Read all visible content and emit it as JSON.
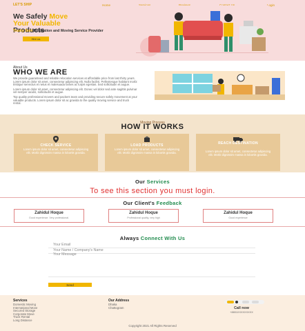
{
  "nav": {
    "logo": "LET'S SHIP",
    "links": [
      "Home",
      "Services",
      "Reviews",
      "Contact Us",
      "Login"
    ]
  },
  "hero": {
    "title_pre": "We Safely ",
    "title_accent1": "Move",
    "title_line2_accent": "Your Valuable",
    "title_line3": "Products",
    "sub_accent": "Trusty Sort",
    "sub_rest": " Relocation and Moving Service Provider",
    "cta": "Hire us"
  },
  "about": {
    "kicker": "About Us",
    "title": "WHO WE ARE",
    "p1": "We provide guaranteed and reliable relocation services at affordable price from last thirty years. Lorem ipsum dolor sit amet, consectetur adipiscing elit. Nulla facilisi. Pellentesque habitant morbi tristique senectus et netus et malesuada fames ac turpis egestas. Sed sollicitudin et augue.",
    "p2": "Lorem ipsum dolor sit amet, consectetur adipiscing elit. Donec vel dolor sed ante sagittis pulvinar vel semper iaculis, sollicitudin et augue.",
    "p3": "Top quality professional movers and packers team and providing secure safely movement at your valuable products. Lorem ipsum dolor sit ac gravida to the quality moving service and truck rental."
  },
  "how": {
    "kicker": "Moving Process",
    "title": "HOW IT WORKS",
    "cards": [
      {
        "icon": "map-pin-icon",
        "title": "CHECK SERVICE",
        "text": "Lorem ipsum dolor sit amet, consectetur adipiscing elit. Morbi dignissim massa in lobortis gravida."
      },
      {
        "icon": "box-icon",
        "title": "LOAD PRODUCTS",
        "text": "Lorem ipsum dolor sit amet, consectetur adipiscing elit. Morbi dignissim massa in lobortis gravida."
      },
      {
        "icon": "truck-icon",
        "title": "REACH DESTINATION",
        "text": "Lorem ipsum dolor sit amet, consectetur adipiscing elit. Morbi dignissim massa in lobortis gravida."
      }
    ]
  },
  "services": {
    "title_pre": "Our ",
    "title_accent": "Services",
    "login_msg": "To see this section you must login."
  },
  "feedback": {
    "title_pre": "Our Client's ",
    "title_accent": "Feedback",
    "items": [
      {
        "name": "Zahidul Hoque",
        "text": "Good experience. Very professional."
      },
      {
        "name": "Zahidul Hoque",
        "text": "Professional quality, very high"
      },
      {
        "name": "Zahidul Hoque",
        "text": "Good experience"
      }
    ]
  },
  "contact": {
    "title_pre": "Always ",
    "title_accent": "Connect With Us",
    "email_ph": "Your Email",
    "name_ph": "Your Name / Company's Name",
    "message_ph": "Your Message",
    "send": "Send"
  },
  "footer": {
    "services_head": "Services",
    "services": [
      "Domestic Moving",
      "International Move",
      "Secured Storage",
      "Corporate Move",
      "Truck Rental",
      "Long Distance"
    ],
    "address_head": "Our Address",
    "address": [
      "Dhaka",
      "Chattogram"
    ],
    "call_label": "Call now",
    "phone": "+8801XXXXXXXXX",
    "copyright": "Copyright 2021 All Rights Reserved"
  }
}
